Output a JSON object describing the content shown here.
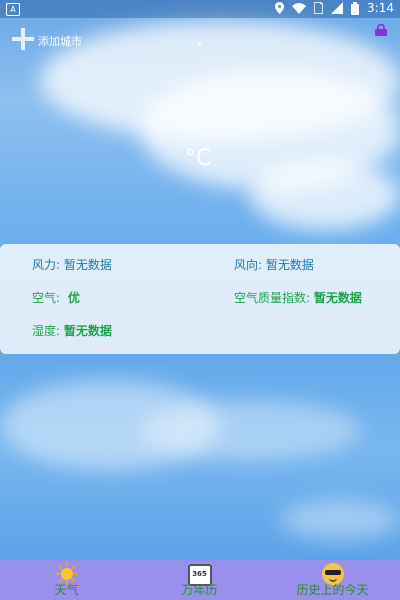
{
  "status_bar": {
    "time": "3:14",
    "left_badge": "A"
  },
  "header": {
    "add_city_label": "添加城市"
  },
  "weather": {
    "temperature_unit": "°C",
    "wind_power_label": "风力:",
    "wind_power_value": "暂无数据",
    "wind_direction_label": "风向:",
    "wind_direction_value": "暂无数据",
    "air_label": "空气:",
    "air_value": "优",
    "aqi_label": "空气质量指数:",
    "aqi_value": "暂无数据",
    "humidity_label": "湿度:",
    "humidity_value": "暂无数据"
  },
  "tabs": [
    {
      "label": "天气",
      "icon": "sun-icon"
    },
    {
      "label": "万年历",
      "icon": "calendar-icon",
      "icon_text": "365"
    },
    {
      "label": "历史上的今天",
      "icon": "sunglasses-face-icon"
    }
  ],
  "colors": {
    "bottom_bar": "#9a8fea",
    "label_blue": "#1d79a6",
    "value_green": "#1aa34a"
  }
}
